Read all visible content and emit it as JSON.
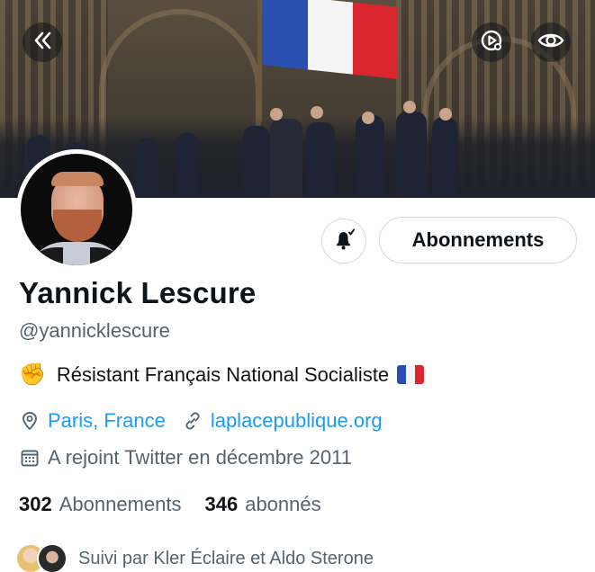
{
  "banner": {
    "back_icon": "chevrons-left-icon",
    "play_icon": "media-icon",
    "view_icon": "eye-icon",
    "flag_colors": [
      "#2a4fb0",
      "#f4f4f4",
      "#d9262f"
    ]
  },
  "profile": {
    "name": "Yannick Lescure",
    "handle": "@yannicklescure",
    "bio": "Résistant Français National Socialiste",
    "bio_emoji_prefix": "✊",
    "location": "Paris, France",
    "website": "laplacepublique.org",
    "joined": "A rejoint Twitter en décembre 2011"
  },
  "actions": {
    "notify_icon": "bell-icon",
    "follow_label": "Abonnements"
  },
  "stats": {
    "following_count": "302",
    "following_label": "Abonnements",
    "followers_count": "346",
    "followers_label": "abonnés"
  },
  "followed_by": {
    "text": "Suivi par Kler Éclaire et Aldo Sterone"
  },
  "colors": {
    "accent": "#1d9bf0",
    "secondary_text": "#536471",
    "border": "#cfd9de"
  }
}
